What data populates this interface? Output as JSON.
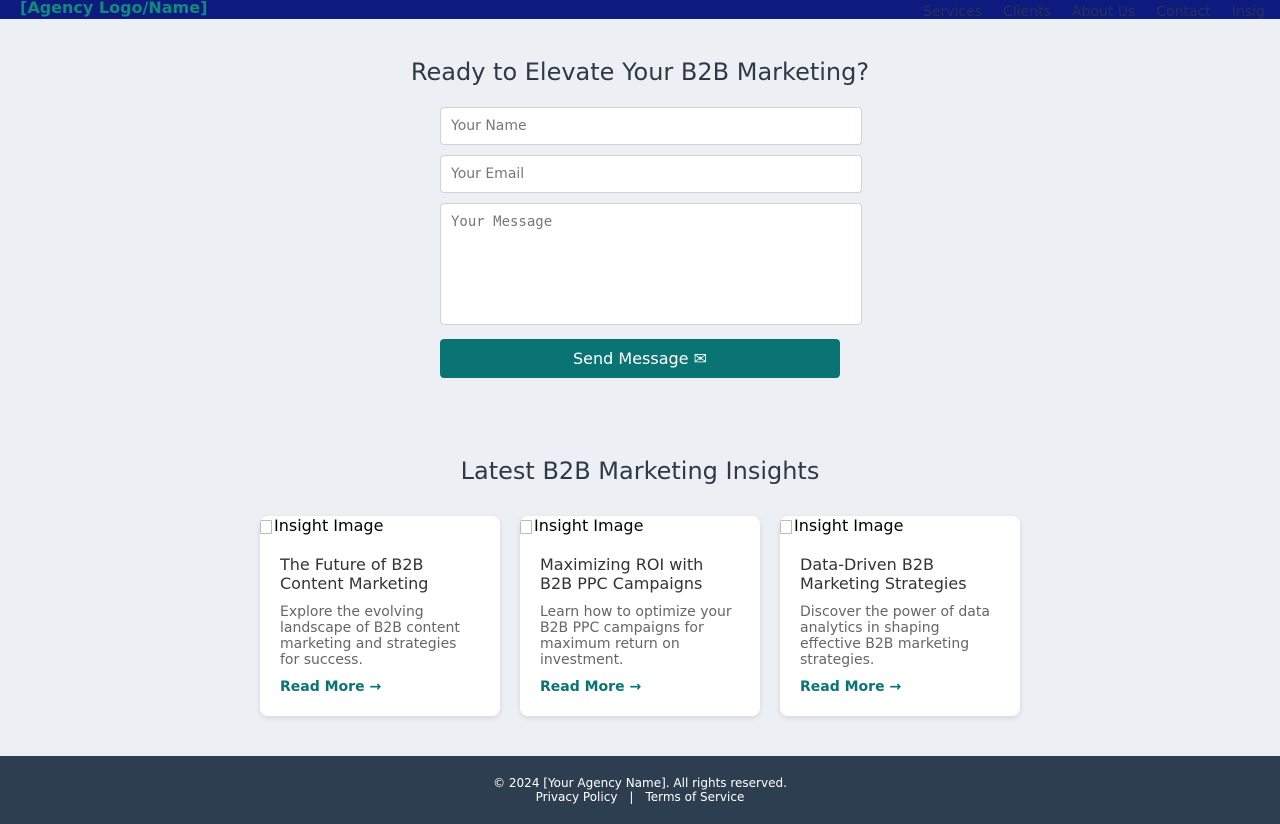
{
  "header": {
    "logo": "[Agency Logo/Name]",
    "nav": [
      "Services",
      "Clients",
      "About Us",
      "Contact",
      "Insig"
    ]
  },
  "contact": {
    "title": "Ready to Elevate Your B2B Marketing?",
    "name_placeholder": "Your Name",
    "email_placeholder": "Your Email",
    "message_placeholder": "Your Message",
    "submit_label": "Send Message ✉"
  },
  "insights": {
    "title": "Latest B2B Marketing Insights",
    "cards": [
      {
        "image_alt": "Insight Image",
        "title": "The Future of B2B Content Marketing",
        "description": "Explore the evolving landscape of B2B content marketing and strategies for success.",
        "link": "Read More →"
      },
      {
        "image_alt": "Insight Image",
        "title": "Maximizing ROI with B2B PPC Campaigns",
        "description": "Learn how to optimize your B2B PPC campaigns for maximum return on investment.",
        "link": "Read More →"
      },
      {
        "image_alt": "Insight Image",
        "title": "Data-Driven B2B Marketing Strategies",
        "description": "Discover the power of data analytics in shaping effective B2B marketing strategies.",
        "link": "Read More →"
      }
    ]
  },
  "footer": {
    "copyright": "© 2024 [Your Agency Name]. All rights reserved.",
    "privacy": "Privacy Policy",
    "separator": "|",
    "terms": "Terms of Service"
  },
  "colors": {
    "header_bg": "#0d1b7e",
    "accent": "#0a7373",
    "page_bg": "#ecf0f5",
    "footer_bg": "#2d3e50"
  }
}
